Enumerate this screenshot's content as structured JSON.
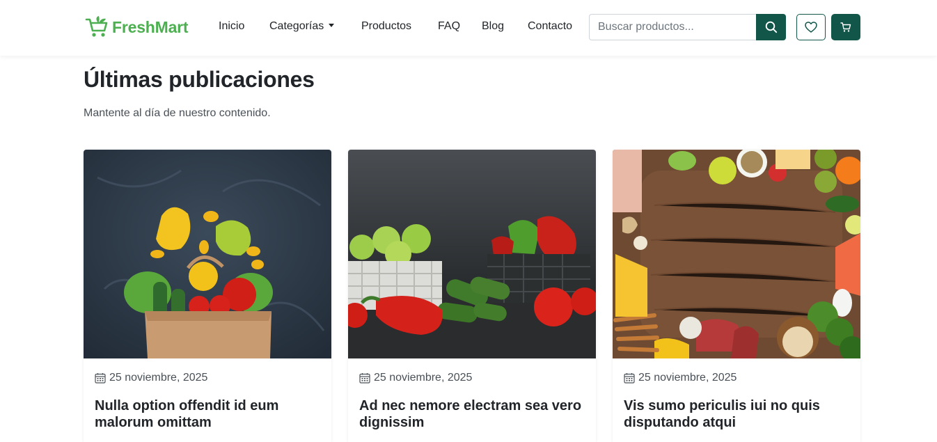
{
  "brand": {
    "name": "FreshMart",
    "color": "#4caf50",
    "icon": "shopping-cart-leaf-icon"
  },
  "nav": {
    "items": [
      {
        "label": "Inicio"
      },
      {
        "label": "Categorías",
        "dropdown": true
      },
      {
        "label": "Productos"
      },
      {
        "label": "FAQ"
      },
      {
        "label": "Blog"
      },
      {
        "label": "Contacto"
      }
    ]
  },
  "search": {
    "placeholder": "Buscar productos...",
    "value": "",
    "icon": "search-icon"
  },
  "actions": {
    "wishlist_icon": "heart-icon",
    "cart_icon": "cart-icon"
  },
  "colors": {
    "primary": "#12564a",
    "brand_green": "#4caf50",
    "text": "#212529"
  },
  "section": {
    "title": "Últimas publicaciones",
    "subtitle": "Mantente al día de nuestro contenido."
  },
  "posts": [
    {
      "date": "25 noviembre, 2025",
      "title": "Nulla option offendit id eum malorum omittam",
      "image": "vegetables-paper-bag-photo"
    },
    {
      "date": "25 noviembre, 2025",
      "title": "Ad nec nemore electram sea vero dignissim",
      "image": "vegetables-baskets-photo"
    },
    {
      "date": "25 noviembre, 2025",
      "title": "Vis sumo periculis iui no quis disputando atqui",
      "image": "food-frame-cutting-board-photo"
    }
  ]
}
